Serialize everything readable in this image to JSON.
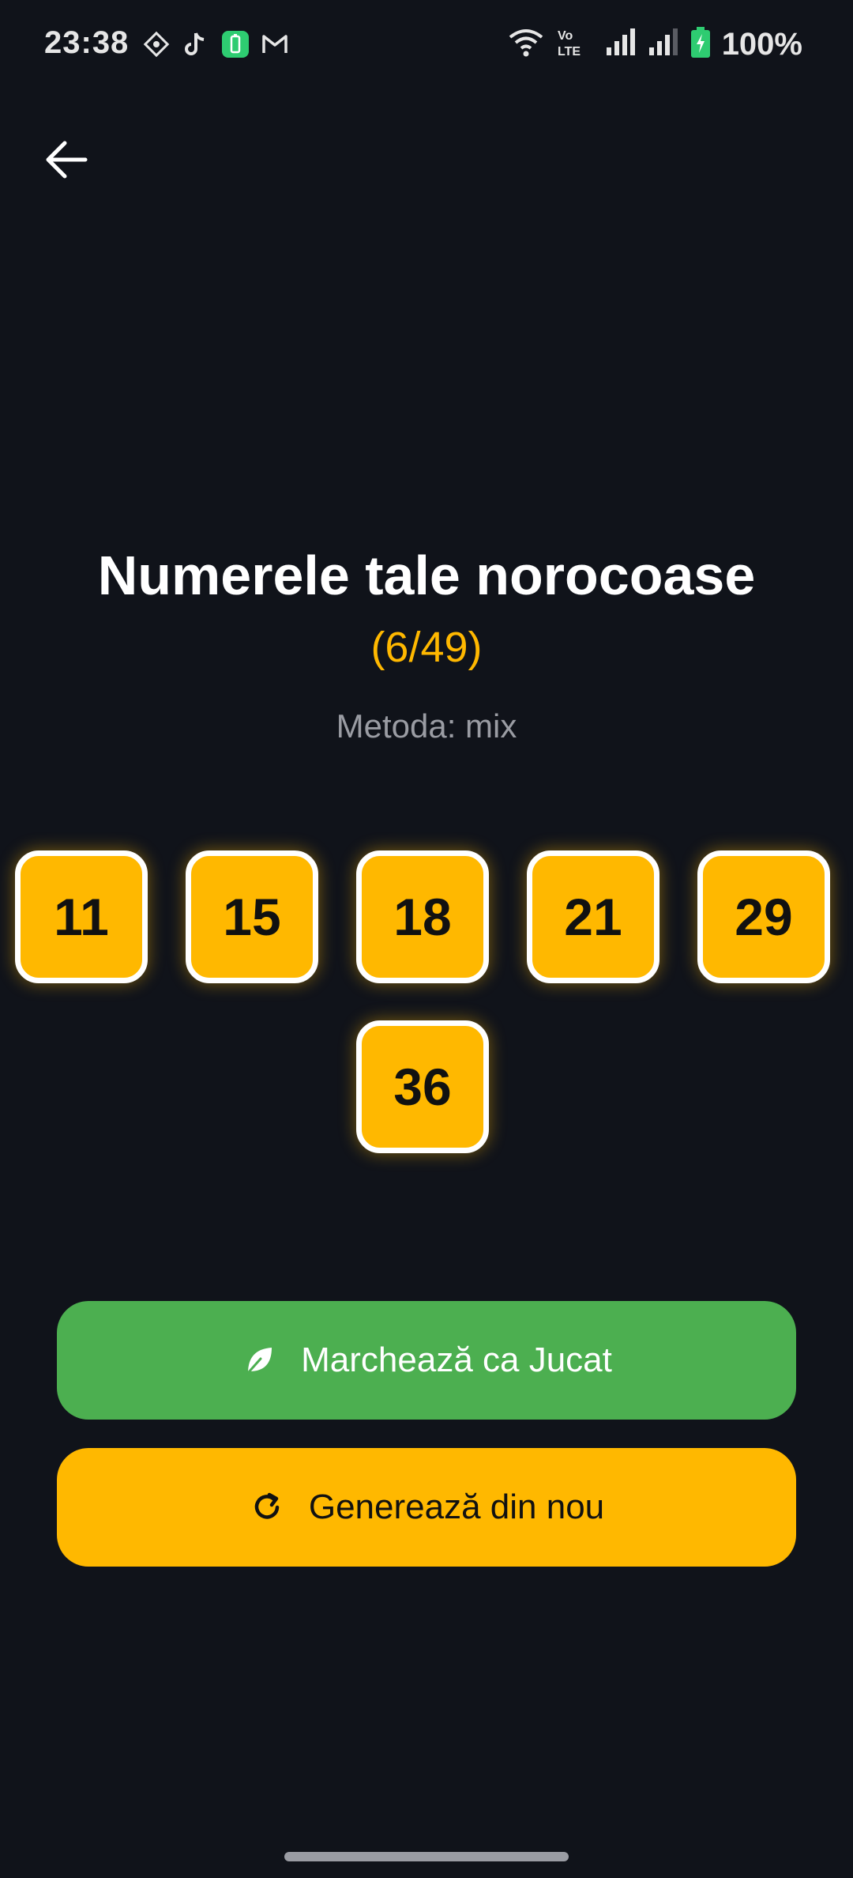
{
  "status_bar": {
    "time": "23:38",
    "notification_icons": [
      "settings-gear-icon",
      "tiktok-icon",
      "battery-saver-icon",
      "gmail-icon"
    ],
    "system_icons": [
      "wifi-icon",
      "volte-icon",
      "signal-icon",
      "signal-icon"
    ],
    "battery_percent": "100%"
  },
  "header": {
    "back_icon": "arrow-left-icon"
  },
  "main": {
    "title": "Numerele tale norocoase",
    "subtitle": "(6/49)",
    "method_label": "Metoda: mix",
    "numbers": [
      "11",
      "15",
      "18",
      "21",
      "29",
      "36"
    ]
  },
  "actions": {
    "mark_played_label": "Marchează ca Jucat",
    "mark_played_icon": "leaf-icon",
    "regenerate_label": "Generează din nou",
    "regenerate_icon": "refresh-icon"
  },
  "colors": {
    "background": "#10131a",
    "accent_yellow": "#ffb800",
    "accent_green": "#4caf50",
    "text_muted": "#9a9ca3"
  }
}
